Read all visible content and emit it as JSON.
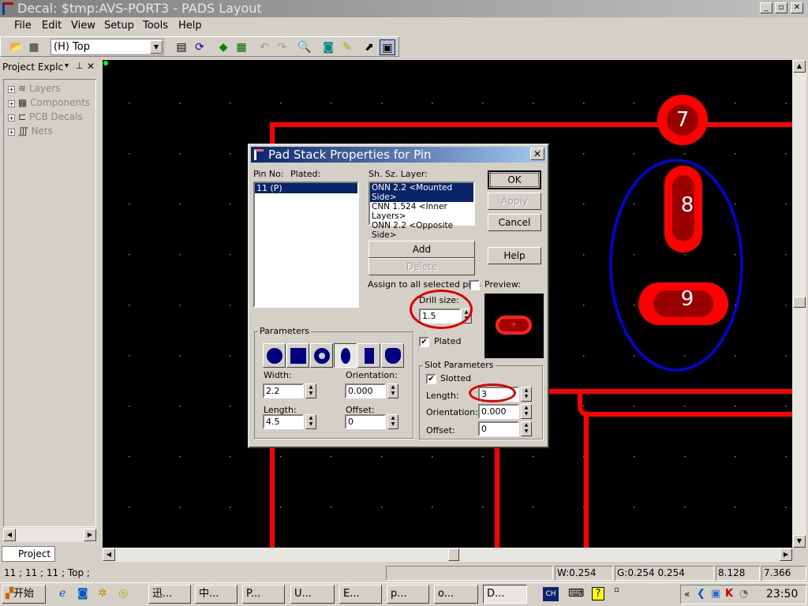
{
  "window": {
    "title": "Decal: $tmp:AVS-PORT3 - PADS Layout",
    "min": "_",
    "max": "▫",
    "close": "✕"
  },
  "menu": [
    "File",
    "Edit",
    "View",
    "Setup",
    "Tools",
    "Help"
  ],
  "toolbar": {
    "layer_combo": "(H) Top",
    "icons": [
      "open-icon",
      "save-icon",
      "properties-icon",
      "refresh-icon",
      "shapes-icon",
      "board-icon",
      "undo-icon",
      "redo-icon",
      "zoom-icon",
      "view-icon",
      "brush-icon",
      "tool-icon",
      "window-icon"
    ]
  },
  "explorer": {
    "title": "Project Explc",
    "items": [
      "Layers",
      "Components",
      "PCB Decals",
      "Nets"
    ],
    "tab": "Project"
  },
  "canvas": {
    "pads": [
      "7",
      "8",
      "9"
    ],
    "colors": {
      "trace": "#ff0000",
      "pad_inner": "#9a0000",
      "highlight": "#0000ff"
    }
  },
  "dialog": {
    "title": "Pad Stack Properties for Pin",
    "pin_no_label": "Pin No:",
    "plated_label": "Plated:",
    "pins": [
      "11 (P)"
    ],
    "layer_label": "Sh. Sz. Layer:",
    "layers": [
      "ONN 2.2 <Mounted Side>",
      "CNN 1.524 <Inner Layers>",
      "ONN 2.2 <Opposite Side>"
    ],
    "ok": "OK",
    "apply": "Apply",
    "cancel": "Cancel",
    "help": "Help",
    "add": "Add",
    "delete": "Delete",
    "assign_all": "Assign to all selected pins",
    "preview": "Preview:",
    "drill_label": "Drill size:",
    "drill": "1.5",
    "plated_chk": "Plated",
    "parameters": "Parameters",
    "width_label": "Width:",
    "width": "2.2",
    "orient_label": "Orientation:",
    "orient": "0.000",
    "length_label": "Length:",
    "length": "4.5",
    "offset_label": "Offset:",
    "offset": "0",
    "slot": {
      "title": "Slot Parameters",
      "slotted": "Slotted",
      "length_label": "Length:",
      "length": "3",
      "orient_label": "Orientation:",
      "orient": "0.000",
      "offset_label": "Offset:",
      "offset": "0"
    }
  },
  "status": {
    "text": "11 ; 11 ; 11 ; Top ;",
    "w": "W:0.254",
    "g": "G:0.254 0.254",
    "x": "8.128",
    "y": "7.366"
  },
  "taskbar": {
    "start": "开始",
    "tasks": [
      "迅...",
      "中...",
      "P...",
      "U...",
      "E...",
      "p...",
      "o...",
      "D..."
    ],
    "ime": "CH",
    "clock": "23:50"
  }
}
